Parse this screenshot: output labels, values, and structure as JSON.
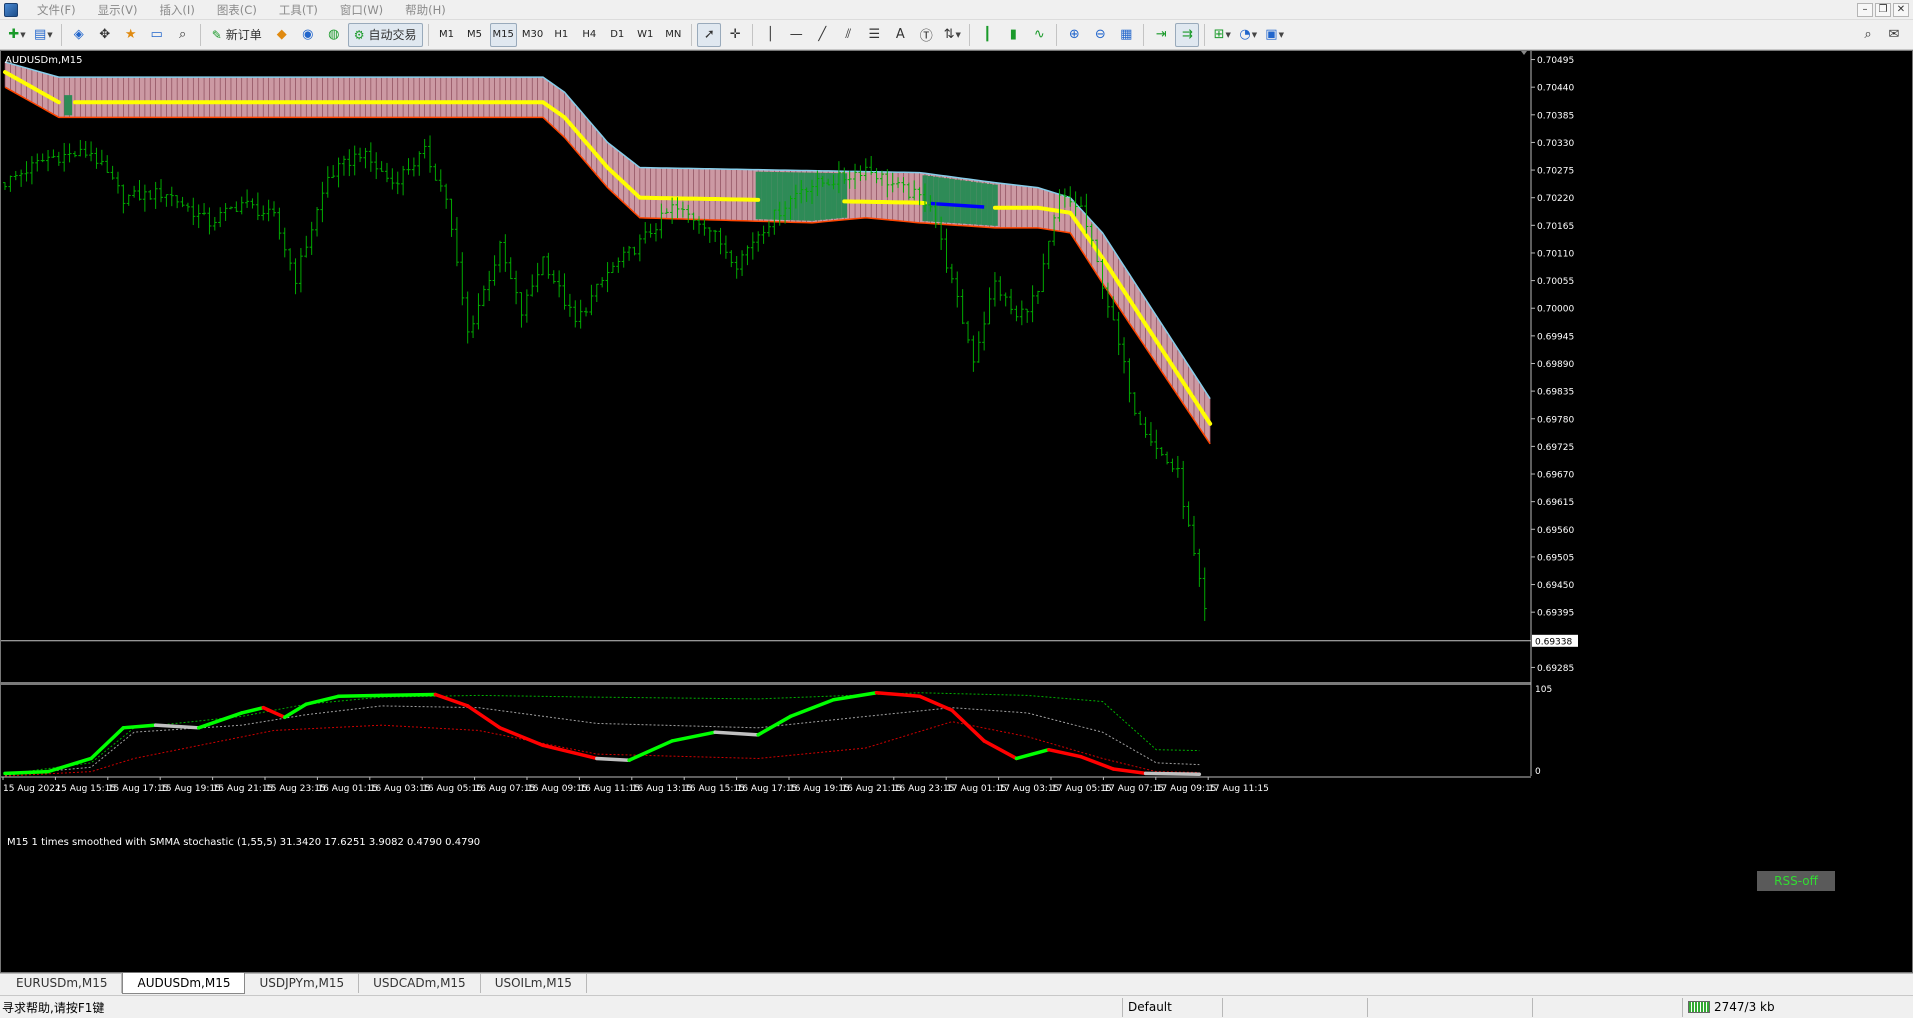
{
  "menu": [
    "文件(F)",
    "显示(V)",
    "插入(I)",
    "图表(C)",
    "工具(T)",
    "窗口(W)",
    "帮助(H)"
  ],
  "toolbar": {
    "new_order": "新订单",
    "auto_trading": "自动交易",
    "timeframes": [
      "M1",
      "M5",
      "M15",
      "M30",
      "H1",
      "H4",
      "D1",
      "W1",
      "MN"
    ],
    "active_timeframe": "M15"
  },
  "chart": {
    "title": "AUDUSDm,M15",
    "indicator_title": "M15 1 times smoothed with SMMA stochastic (1,55,5) 31.3420 17.6251 3.9082 0.4790 0.4790",
    "rss_button": "RSS-off",
    "current_price_label": "0.69338",
    "colors": {
      "background": "#000000",
      "bars": "#00aa00",
      "envelope_fill": "#f0b4c0",
      "envelope_upper": "#87ceeb",
      "envelope_lower": "#ff4500",
      "midline_yellow": "#ffff00",
      "midline_blue": "#0000ff",
      "flat_zone": "#2e8b57",
      "stoch_up": "#00ff00",
      "stoch_down": "#ff0000",
      "stoch_neutral": "#c0c0c0"
    }
  },
  "chart_data": {
    "price_chart": {
      "type": "ohlc",
      "symbol": "AUDUSDm",
      "timeframe": "M15",
      "y_ticks": [
        0.70495,
        0.7044,
        0.70385,
        0.7033,
        0.70275,
        0.7022,
        0.70165,
        0.7011,
        0.70055,
        0.7,
        0.69945,
        0.6989,
        0.69835,
        0.6978,
        0.69725,
        0.6967,
        0.69615,
        0.6956,
        0.69505,
        0.6945,
        0.69395,
        0.69285
      ],
      "ylim": [
        0.69258,
        0.70512
      ],
      "current_price": 0.69338,
      "x_labels": [
        "15 Aug 2022",
        "15 Aug 15:15",
        "15 Aug 17:15",
        "15 Aug 19:15",
        "15 Aug 21:15",
        "15 Aug 23:15",
        "16 Aug 01:15",
        "16 Aug 03:15",
        "16 Aug 05:15",
        "16 Aug 07:15",
        "16 Aug 09:15",
        "16 Aug 11:15",
        "16 Aug 13:15",
        "16 Aug 15:15",
        "16 Aug 17:15",
        "16 Aug 19:15",
        "16 Aug 21:15",
        "16 Aug 23:15",
        "17 Aug 01:15",
        "17 Aug 03:15",
        "17 Aug 05:15",
        "17 Aug 07:15",
        "17 Aug 09:15",
        "17 Aug 11:15"
      ],
      "bar_count": 224,
      "close_path": [
        [
          0,
          0.7025
        ],
        [
          8,
          0.703
        ],
        [
          16,
          0.7031
        ],
        [
          22,
          0.7022
        ],
        [
          30,
          0.7023
        ],
        [
          38,
          0.7017
        ],
        [
          44,
          0.7021
        ],
        [
          50,
          0.7018
        ],
        [
          54,
          0.7006
        ],
        [
          60,
          0.7026
        ],
        [
          66,
          0.7031
        ],
        [
          72,
          0.7025
        ],
        [
          78,
          0.7031
        ],
        [
          82,
          0.7022
        ],
        [
          86,
          0.6995
        ],
        [
          92,
          0.7012
        ],
        [
          96,
          0.6999
        ],
        [
          100,
          0.701
        ],
        [
          106,
          0.6997
        ],
        [
          112,
          0.7007
        ],
        [
          118,
          0.7013
        ],
        [
          124,
          0.702
        ],
        [
          130,
          0.7017
        ],
        [
          136,
          0.7009
        ],
        [
          140,
          0.7015
        ],
        [
          148,
          0.7024
        ],
        [
          156,
          0.7026
        ],
        [
          160,
          0.7028
        ],
        [
          166,
          0.7024
        ],
        [
          172,
          0.7021
        ],
        [
          176,
          0.7005
        ],
        [
          180,
          0.699
        ],
        [
          184,
          0.7005
        ],
        [
          188,
          0.6998
        ],
        [
          192,
          0.7003
        ],
        [
          196,
          0.7022
        ],
        [
          200,
          0.702
        ],
        [
          204,
          0.7005
        ],
        [
          210,
          0.698
        ],
        [
          214,
          0.6972
        ],
        [
          218,
          0.6967
        ],
        [
          222,
          0.6945
        ],
        [
          224,
          0.6934
        ]
      ],
      "envelope": {
        "upper": [
          [
            0,
            0.7049
          ],
          [
            10,
            0.7046
          ],
          [
            100,
            0.7046
          ],
          [
            104,
            0.7043
          ],
          [
            112,
            0.7033
          ],
          [
            118,
            0.7028
          ],
          [
            170,
            0.7027
          ],
          [
            184,
            0.7025
          ],
          [
            192,
            0.7024
          ],
          [
            198,
            0.7022
          ],
          [
            204,
            0.7015
          ],
          [
            224,
            0.6982
          ]
        ],
        "middle": [
          [
            0,
            0.7047
          ],
          [
            10,
            0.7041
          ],
          [
            100,
            0.7041
          ],
          [
            104,
            0.7038
          ],
          [
            112,
            0.7028
          ],
          [
            118,
            0.7022
          ],
          [
            170,
            0.7021
          ],
          [
            184,
            0.702
          ],
          [
            192,
            0.702
          ],
          [
            198,
            0.7019
          ],
          [
            204,
            0.701
          ],
          [
            224,
            0.6977
          ]
        ],
        "lower": [
          [
            0,
            0.7044
          ],
          [
            10,
            0.7038
          ],
          [
            100,
            0.7038
          ],
          [
            104,
            0.7034
          ],
          [
            112,
            0.7024
          ],
          [
            118,
            0.7018
          ],
          [
            150,
            0.7017
          ],
          [
            160,
            0.7018
          ],
          [
            170,
            0.7017
          ],
          [
            184,
            0.7016
          ],
          [
            192,
            0.7016
          ],
          [
            198,
            0.7015
          ],
          [
            204,
            0.7005
          ],
          [
            224,
            0.6973
          ]
        ],
        "flat_zones": [
          [
            140,
            156
          ],
          [
            171,
            184
          ]
        ],
        "blue_segment": [
          172,
          182
        ]
      }
    },
    "stochastic": {
      "type": "line",
      "title": "M15 1 times smoothed with SMMA stochastic (1,55,5)",
      "values_printed": [
        31.342,
        17.6251,
        3.9082,
        0.479,
        0.479
      ],
      "ylim": [
        0,
        105
      ],
      "y_ticks": [
        105,
        0
      ],
      "main": [
        [
          0,
          3
        ],
        [
          8,
          5
        ],
        [
          16,
          20
        ],
        [
          22,
          55
        ],
        [
          28,
          58
        ],
        [
          36,
          55
        ],
        [
          44,
          72
        ],
        [
          48,
          78
        ],
        [
          52,
          67
        ],
        [
          56,
          82
        ],
        [
          62,
          91
        ],
        [
          70,
          92
        ],
        [
          80,
          93
        ],
        [
          86,
          80
        ],
        [
          92,
          55
        ],
        [
          100,
          35
        ],
        [
          110,
          20
        ],
        [
          116,
          18
        ],
        [
          124,
          40
        ],
        [
          132,
          50
        ],
        [
          140,
          47
        ],
        [
          146,
          68
        ],
        [
          154,
          87
        ],
        [
          162,
          95
        ],
        [
          170,
          91
        ],
        [
          176,
          75
        ],
        [
          182,
          40
        ],
        [
          188,
          20
        ],
        [
          194,
          30
        ],
        [
          200,
          22
        ],
        [
          206,
          8
        ],
        [
          212,
          3
        ],
        [
          222,
          2
        ]
      ],
      "upper_band": [
        [
          0,
          2
        ],
        [
          16,
          15
        ],
        [
          24,
          55
        ],
        [
          44,
          68
        ],
        [
          56,
          82
        ],
        [
          70,
          90
        ],
        [
          88,
          92
        ],
        [
          110,
          90
        ],
        [
          140,
          88
        ],
        [
          170,
          95
        ],
        [
          190,
          92
        ],
        [
          204,
          85
        ],
        [
          214,
          30
        ],
        [
          222,
          29
        ]
      ],
      "mid_band": [
        [
          0,
          1
        ],
        [
          16,
          10
        ],
        [
          24,
          50
        ],
        [
          44,
          58
        ],
        [
          56,
          70
        ],
        [
          70,
          80
        ],
        [
          88,
          78
        ],
        [
          110,
          60
        ],
        [
          140,
          55
        ],
        [
          160,
          68
        ],
        [
          176,
          78
        ],
        [
          190,
          72
        ],
        [
          204,
          50
        ],
        [
          214,
          15
        ],
        [
          222,
          13
        ]
      ],
      "lower_band": [
        [
          0,
          0
        ],
        [
          16,
          5
        ],
        [
          24,
          20
        ],
        [
          50,
          52
        ],
        [
          70,
          58
        ],
        [
          88,
          52
        ],
        [
          110,
          25
        ],
        [
          140,
          20
        ],
        [
          160,
          32
        ],
        [
          176,
          62
        ],
        [
          190,
          45
        ],
        [
          204,
          20
        ],
        [
          214,
          5
        ],
        [
          222,
          4
        ]
      ]
    }
  },
  "tabs": [
    "EURUSDm,M15",
    "AUDUSDm,M15",
    "USDJPYm,M15",
    "USDCADm,M15",
    "USOILm,M15"
  ],
  "active_tab": "AUDUSDm,M15",
  "status": {
    "help": "寻求帮助,请按F1键",
    "profile": "Default",
    "traffic": "2747/3 kb"
  }
}
